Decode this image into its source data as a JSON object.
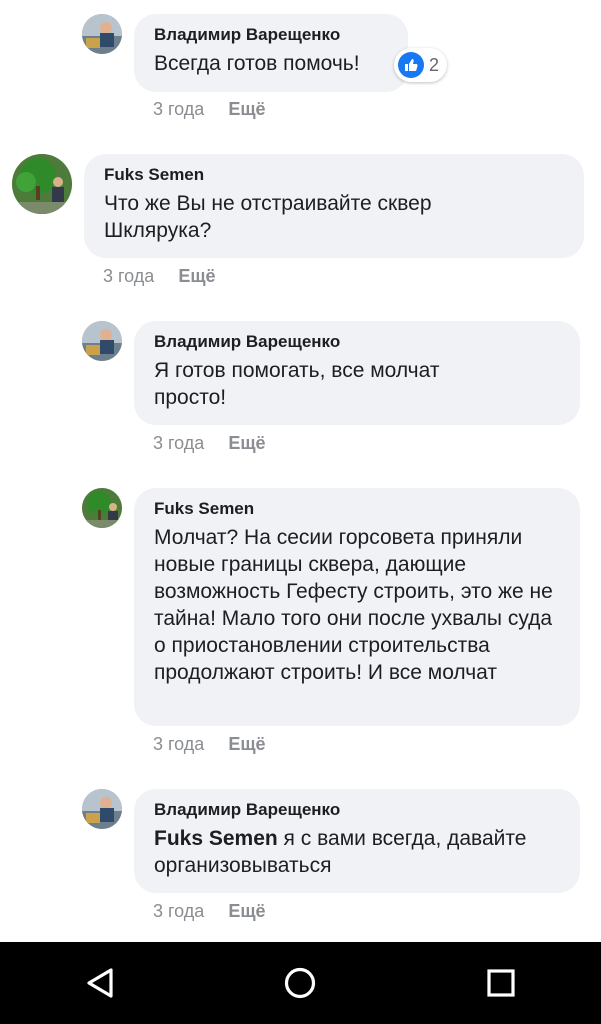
{
  "comments": [
    {
      "author": "Владимир Варещенко",
      "text": "Всегда готов помочь!",
      "time": "3 года",
      "more": "Ещё",
      "reaction_count": "2",
      "avatar": "person-in-car-photo"
    },
    {
      "author": "Fuks Semen",
      "text": "Что же Вы не отстраивайте сквер Шклярука?",
      "time": "3 года",
      "more": "Ещё",
      "avatar": "tree-photo"
    },
    {
      "author": "Владимир Варещенко",
      "text": "Я готов помогать, все молчат просто!",
      "time": "3 года",
      "more": "Ещё",
      "avatar": "person-in-car-photo"
    },
    {
      "author": "Fuks Semen",
      "text": "Молчат? На сесии горсовета приняли новые границы сквера, дающие возможность Гефесту строить, это же не тайна! Мало того они после ухвалы суда о приостановлении строительства продолжают строить! И все молчат",
      "time": "3 года",
      "more": "Ещё",
      "avatar": "tree-photo"
    },
    {
      "author": "Владимир Варещенко",
      "mention": "Fuks Semen",
      "text": " я с вами всегда, давайте организовываться",
      "time": "3 года",
      "more": "Ещё",
      "avatar": "person-in-car-photo"
    }
  ],
  "colors": {
    "bubble": "#f0f2f5",
    "meta_text": "#8a8d91",
    "like_blue": "#1877f2",
    "navbar": "#000000"
  },
  "navbar": {
    "icons": [
      "back-triangle-icon",
      "home-circle-icon",
      "recents-square-icon"
    ]
  }
}
